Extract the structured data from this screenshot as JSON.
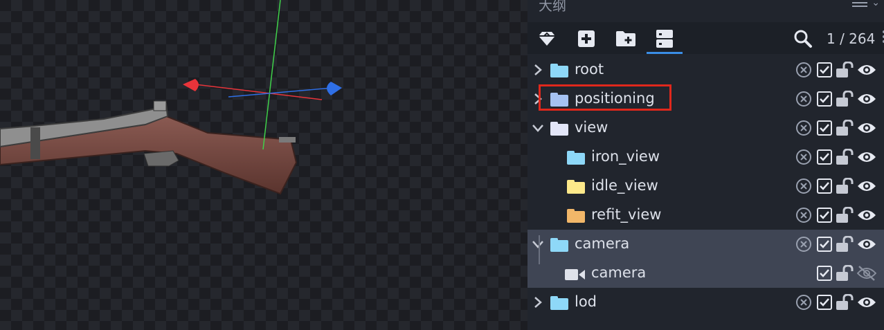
{
  "panel": {
    "title": "大纲",
    "counter": "1 / 264",
    "toolbar": [
      {
        "icon": "gem-icon"
      },
      {
        "icon": "add-icon"
      },
      {
        "icon": "add-folder-icon"
      },
      {
        "icon": "group-icon",
        "active": true
      }
    ]
  },
  "outline": [
    {
      "label": "root",
      "depth": 0,
      "expanded": false,
      "icon": "folder-icon",
      "color": "#8ed8f8",
      "locked": false,
      "visible": true
    },
    {
      "label": "positioning",
      "depth": 0,
      "expanded": false,
      "icon": "folder-icon",
      "color": "#a6c2f2",
      "locked": false,
      "visible": true,
      "selected": true
    },
    {
      "label": "view",
      "depth": 0,
      "expanded": true,
      "icon": "folder-icon",
      "color": "#e3e6f8",
      "locked": false,
      "visible": true
    },
    {
      "label": "iron_view",
      "depth": 1,
      "icon": "folder-icon",
      "color": "#8ed8f8",
      "locked": false,
      "visible": true
    },
    {
      "label": "idle_view",
      "depth": 1,
      "icon": "folder-icon",
      "color": "#fde98a",
      "locked": false,
      "visible": true
    },
    {
      "label": "refit_view",
      "depth": 1,
      "icon": "folder-icon",
      "color": "#f2b769",
      "locked": false,
      "visible": true
    },
    {
      "label": "camera",
      "depth": 0,
      "expanded": true,
      "icon": "folder-icon",
      "color": "#8ed8f8",
      "locked": false,
      "visible": true,
      "highlighted": true
    },
    {
      "label": "camera",
      "depth": 1,
      "icon": "camera-icon",
      "color": "#dfe2ea",
      "locked": false,
      "visible": false,
      "highlighted": true
    },
    {
      "label": "lod",
      "depth": 0,
      "expanded": false,
      "icon": "folder-icon",
      "color": "#8ed8f8",
      "locked": false,
      "visible": true
    }
  ],
  "colors": {
    "accent": "#3a8ee6",
    "selection_box": "#e0281c",
    "axis_x": "#e8343a",
    "axis_y": "#3fd14a",
    "axis_z": "#2f6fe6"
  }
}
